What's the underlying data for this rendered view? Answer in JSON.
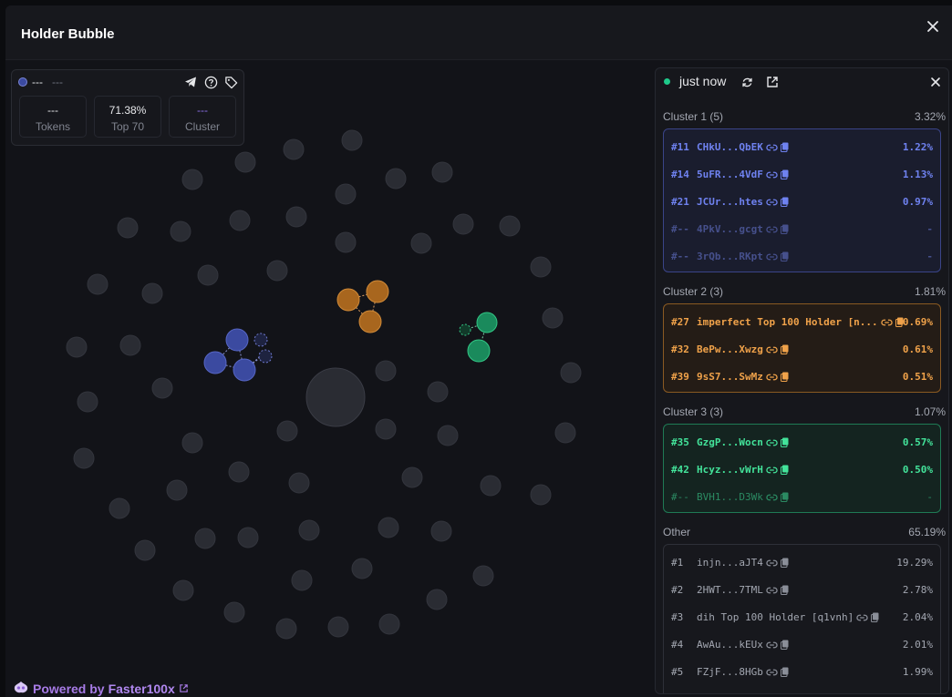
{
  "window": {
    "title": "Holder Bubble"
  },
  "info": {
    "name": "---",
    "symbol": "---",
    "stats": [
      {
        "value": "---",
        "label": "Tokens"
      },
      {
        "value": "71.38%",
        "label": "Top 70"
      },
      {
        "value": "---",
        "label": "Cluster"
      }
    ]
  },
  "panel": {
    "time": "just now",
    "sections": [
      {
        "title": "Cluster 1 (5)",
        "pct": "3.32%",
        "color": "#6f82f0",
        "rows": [
          {
            "rank": "#11",
            "addr": "CHkU...QbEK",
            "pct": "1.22%",
            "dim": false
          },
          {
            "rank": "#14",
            "addr": "5uFR...4VdF",
            "pct": "1.13%",
            "dim": false
          },
          {
            "rank": "#21",
            "addr": "JCUr...htes",
            "pct": "0.97%",
            "dim": false
          },
          {
            "rank": "#--",
            "addr": "4PkV...gcgt",
            "pct": "-",
            "dim": true
          },
          {
            "rank": "#--",
            "addr": "3rQb...RKpt",
            "pct": "-",
            "dim": true
          }
        ]
      },
      {
        "title": "Cluster 2 (3)",
        "pct": "1.81%",
        "color": "#f0a24a",
        "rows": [
          {
            "rank": "#27",
            "addr": "imperfect Top 100 Holder [n...",
            "pct": "0.69%",
            "dim": false
          },
          {
            "rank": "#32",
            "addr": "BePw...Xwzg",
            "pct": "0.61%",
            "dim": false
          },
          {
            "rank": "#39",
            "addr": "9sS7...SwMz",
            "pct": "0.51%",
            "dim": false
          }
        ]
      },
      {
        "title": "Cluster 3 (3)",
        "pct": "1.07%",
        "color": "#43e39a",
        "rows": [
          {
            "rank": "#35",
            "addr": "GzgP...Wocn",
            "pct": "0.57%",
            "dim": false
          },
          {
            "rank": "#42",
            "addr": "Hcyz...vWrH",
            "pct": "0.50%",
            "dim": false
          },
          {
            "rank": "#--",
            "addr": "BVH1...D3Wk",
            "pct": "-",
            "dim": true
          }
        ]
      },
      {
        "title": "Other",
        "pct": "65.19%",
        "color": "#a3a7b1",
        "rows": [
          {
            "rank": "#1",
            "addr": "injn...aJT4",
            "pct": "19.29%",
            "dim": false
          },
          {
            "rank": "#2",
            "addr": "2HWT...7TML",
            "pct": "2.78%",
            "dim": false
          },
          {
            "rank": "#3",
            "addr": "dih Top 100 Holder [q1vnh]",
            "pct": "2.04%",
            "dim": false
          },
          {
            "rank": "#4",
            "addr": "AwAu...kEUx",
            "pct": "2.01%",
            "dim": false
          },
          {
            "rank": "#5",
            "addr": "FZjF...8HGb",
            "pct": "1.99%",
            "dim": false
          }
        ]
      }
    ]
  },
  "footer": {
    "powered_label": "Powered by",
    "brand": "Faster100x"
  },
  "colors": {
    "cluster1": "#3b4aa0",
    "cluster2": "#c07a26",
    "cluster3": "#1f9a66",
    "bubble": "#2b2d34"
  }
}
